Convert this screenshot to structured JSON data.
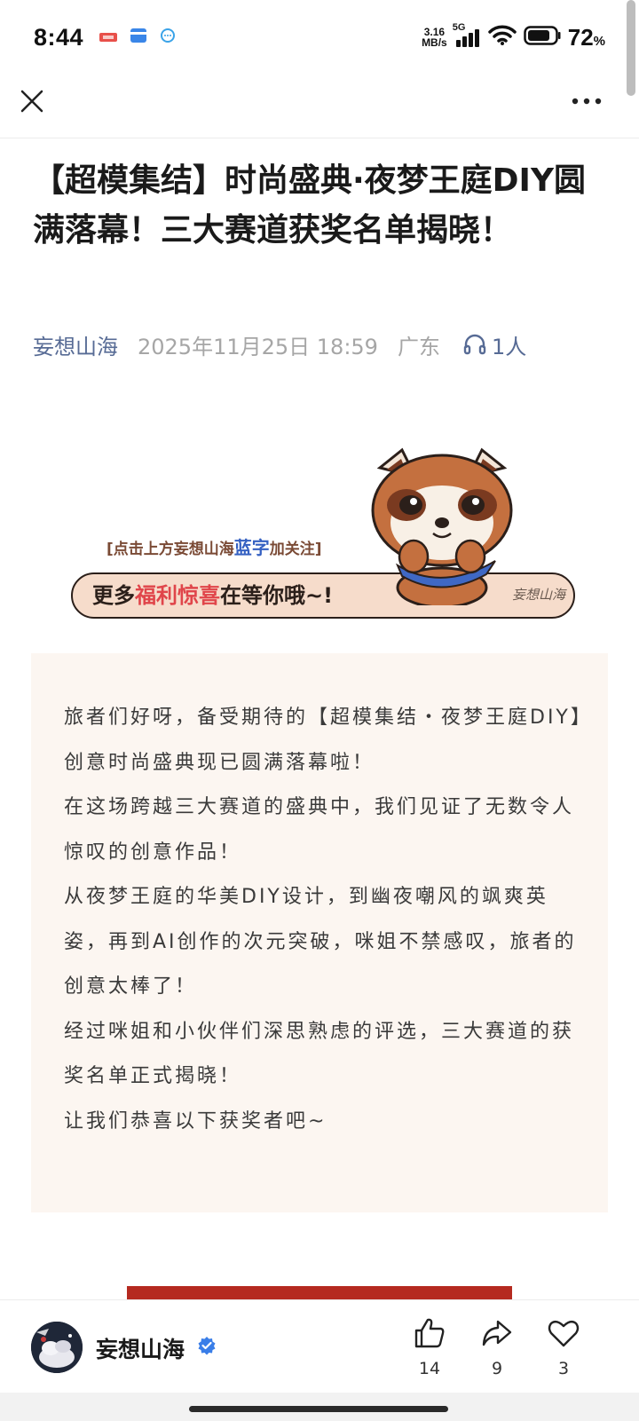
{
  "status_bar": {
    "time": "8:44",
    "net_speed_value": "3.16",
    "net_speed_unit": "MB/s",
    "network_type": "5G",
    "battery_percent": "72",
    "battery_percent_sign": "%"
  },
  "toolbar": {
    "close_icon": "close-icon",
    "more_icon": "more-icon"
  },
  "article": {
    "title": "【超模集结】时尚盛典·夜梦王庭DIY圆满落幕！三大赛道获奖名单揭晓！",
    "author": "妄想山海",
    "date": "2025年11月25日 18:59",
    "location": "广东",
    "listeners": "1人"
  },
  "banner": {
    "hint_prefix": "[点击上方妄想山海",
    "hint_blue": "蓝字",
    "hint_suffix": "加关注]",
    "slogan_1": "更多",
    "slogan_2": "福利惊喜",
    "slogan_3": "在等你哦~!",
    "signature": "妄想山海"
  },
  "intro": {
    "paragraphs": [
      "旅者们好呀，备受期待的【超模集结・夜梦王庭DIY】创意时尚盛典现已圆满落幕啦！",
      "在这场跨越三大赛道的盛典中，我们见证了无数令人惊叹的创意作品！",
      "从夜梦王庭的华美DIY设计，到幽夜嘲风的飒爽英姿，再到AI创作的次元突破，咪姐不禁感叹，旅者的创意太棒了！",
      "经过咪姐和小伙伴们深思熟虑的评选，三大赛道的获奖名单正式揭晓！",
      "让我们恭喜以下获奖者吧~"
    ]
  },
  "bottom_bar": {
    "account_name": "妄想山海",
    "like_count": "14",
    "share_count": "9",
    "favorite_count": "3"
  },
  "colors": {
    "link_blue": "#576b95",
    "accent_red": "#b52a20",
    "card_bg": "#fcf6f1"
  }
}
